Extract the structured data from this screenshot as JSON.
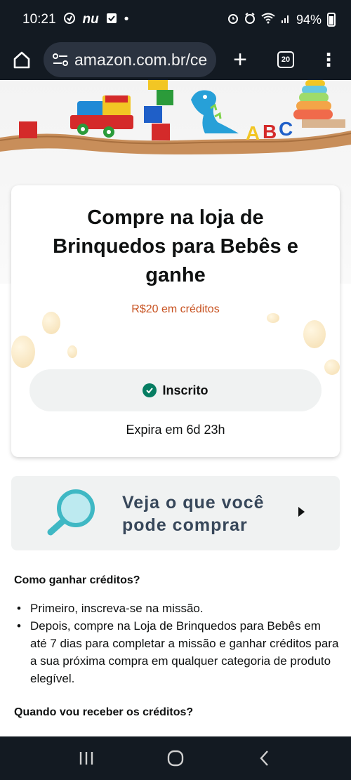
{
  "status_bar": {
    "time": "10:21",
    "carrier_tag": "nu",
    "dot": "•",
    "battery": "94%"
  },
  "browser": {
    "url": "amazon.com.br/ce",
    "tab_count": "20"
  },
  "promo": {
    "title": "Compre na loja de Brinquedos para Bebês e ganhe",
    "reward": "R$20 em créditos",
    "status_label": "Inscrito",
    "expires": "Expira em 6d 23h"
  },
  "shop_banner": {
    "line1": "Veja o que você",
    "line2": "pode comprar"
  },
  "how_section": {
    "title": "Como ganhar créditos?",
    "bullets": [
      "Primeiro, inscreva-se na missão.",
      "Depois, compre na Loja de Brinquedos para Bebês em até 7 dias para completar a missão e ganhar créditos para a sua próxima compra em qualquer categoria de produto elegível."
    ]
  },
  "when_section": {
    "title": "Quando vou receber os créditos?"
  },
  "hero_letters": [
    "A",
    "B",
    "C"
  ],
  "colors": {
    "system_bar": "#131a22",
    "reward_text": "#c7511f",
    "check_green": "#067d62",
    "banner_bg": "#f0f2f2",
    "magnifier": "#3fb8c4"
  }
}
